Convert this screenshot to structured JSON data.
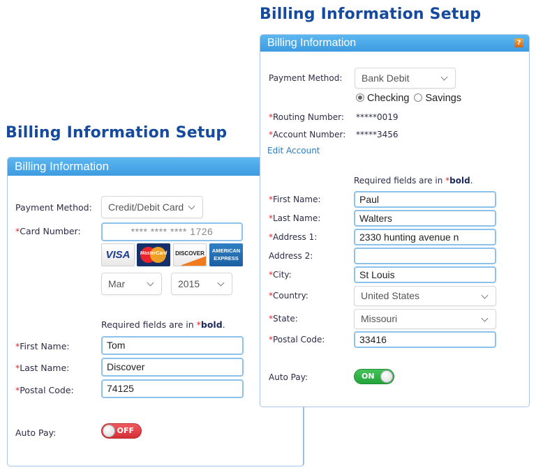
{
  "left": {
    "page_title": "Billing Information Setup",
    "panel_title": "Billing Information",
    "payment_method": {
      "label": "Payment Method:",
      "value": "Credit/Debit Card"
    },
    "card_number": {
      "label": "Card Number:",
      "value": "**** **** **** 1726"
    },
    "card_logos": [
      {
        "name": "visa",
        "text": "VISA"
      },
      {
        "name": "mastercard",
        "text": "MasterCard"
      },
      {
        "name": "discover",
        "text": "DISCOVER"
      },
      {
        "name": "amex",
        "text_line1": "AMERICAN",
        "text_line2": "EXPRESS"
      }
    ],
    "exp_month": "Mar",
    "exp_year": "2015",
    "required_note_prefix": "Required fields are in ",
    "required_note_bold": "bold",
    "required_note_suffix": ".",
    "fields": [
      {
        "label": "First Name:",
        "value": "Tom",
        "required": true
      },
      {
        "label": "Last Name:",
        "value": "Discover",
        "required": true
      },
      {
        "label": "Postal Code:",
        "value": "74125",
        "required": true
      }
    ],
    "auto_pay": {
      "label": "Auto Pay:",
      "state": "OFF",
      "on": false
    }
  },
  "right": {
    "page_title": "Billing Information Setup",
    "panel_title": "Billing Information",
    "help_icon": "?",
    "payment_method": {
      "label": "Payment Method:",
      "value": "Bank Debit"
    },
    "account_type": {
      "options": [
        "Checking",
        "Savings"
      ],
      "selected": "Checking"
    },
    "routing_number": {
      "label": "Routing Number:",
      "value": "*****0019"
    },
    "account_number": {
      "label": "Account Number:",
      "value": "*****3456"
    },
    "edit_account_link": "Edit Account",
    "required_note_prefix": "Required fields are in ",
    "required_note_bold": "bold",
    "required_note_suffix": ".",
    "fields": [
      {
        "label": "First Name:",
        "value": "Paul",
        "required": true
      },
      {
        "label": "Last Name:",
        "value": "Walters",
        "required": true
      },
      {
        "label": "Address 1:",
        "value": "2330 hunting avenue n",
        "required": true
      },
      {
        "label": "Address 2:",
        "value": "",
        "required": false
      },
      {
        "label": "City:",
        "value": "St Louis",
        "required": true
      }
    ],
    "country": {
      "label": "Country:",
      "value": "United States"
    },
    "state": {
      "label": "State:",
      "value": "Missouri"
    },
    "postal_code": {
      "label": "Postal Code:",
      "value": "33416"
    },
    "auto_pay": {
      "label": "Auto Pay:",
      "state": "ON",
      "on": true
    }
  },
  "required_marker": "*",
  "colors": {
    "title_blue": "#164a9c",
    "header_blue": "#3d9be0",
    "required_red": "#e0262b",
    "toggle_on_green": "#23a33b",
    "toggle_off_red": "#d42e36",
    "link_blue": "#2a7bbf"
  }
}
